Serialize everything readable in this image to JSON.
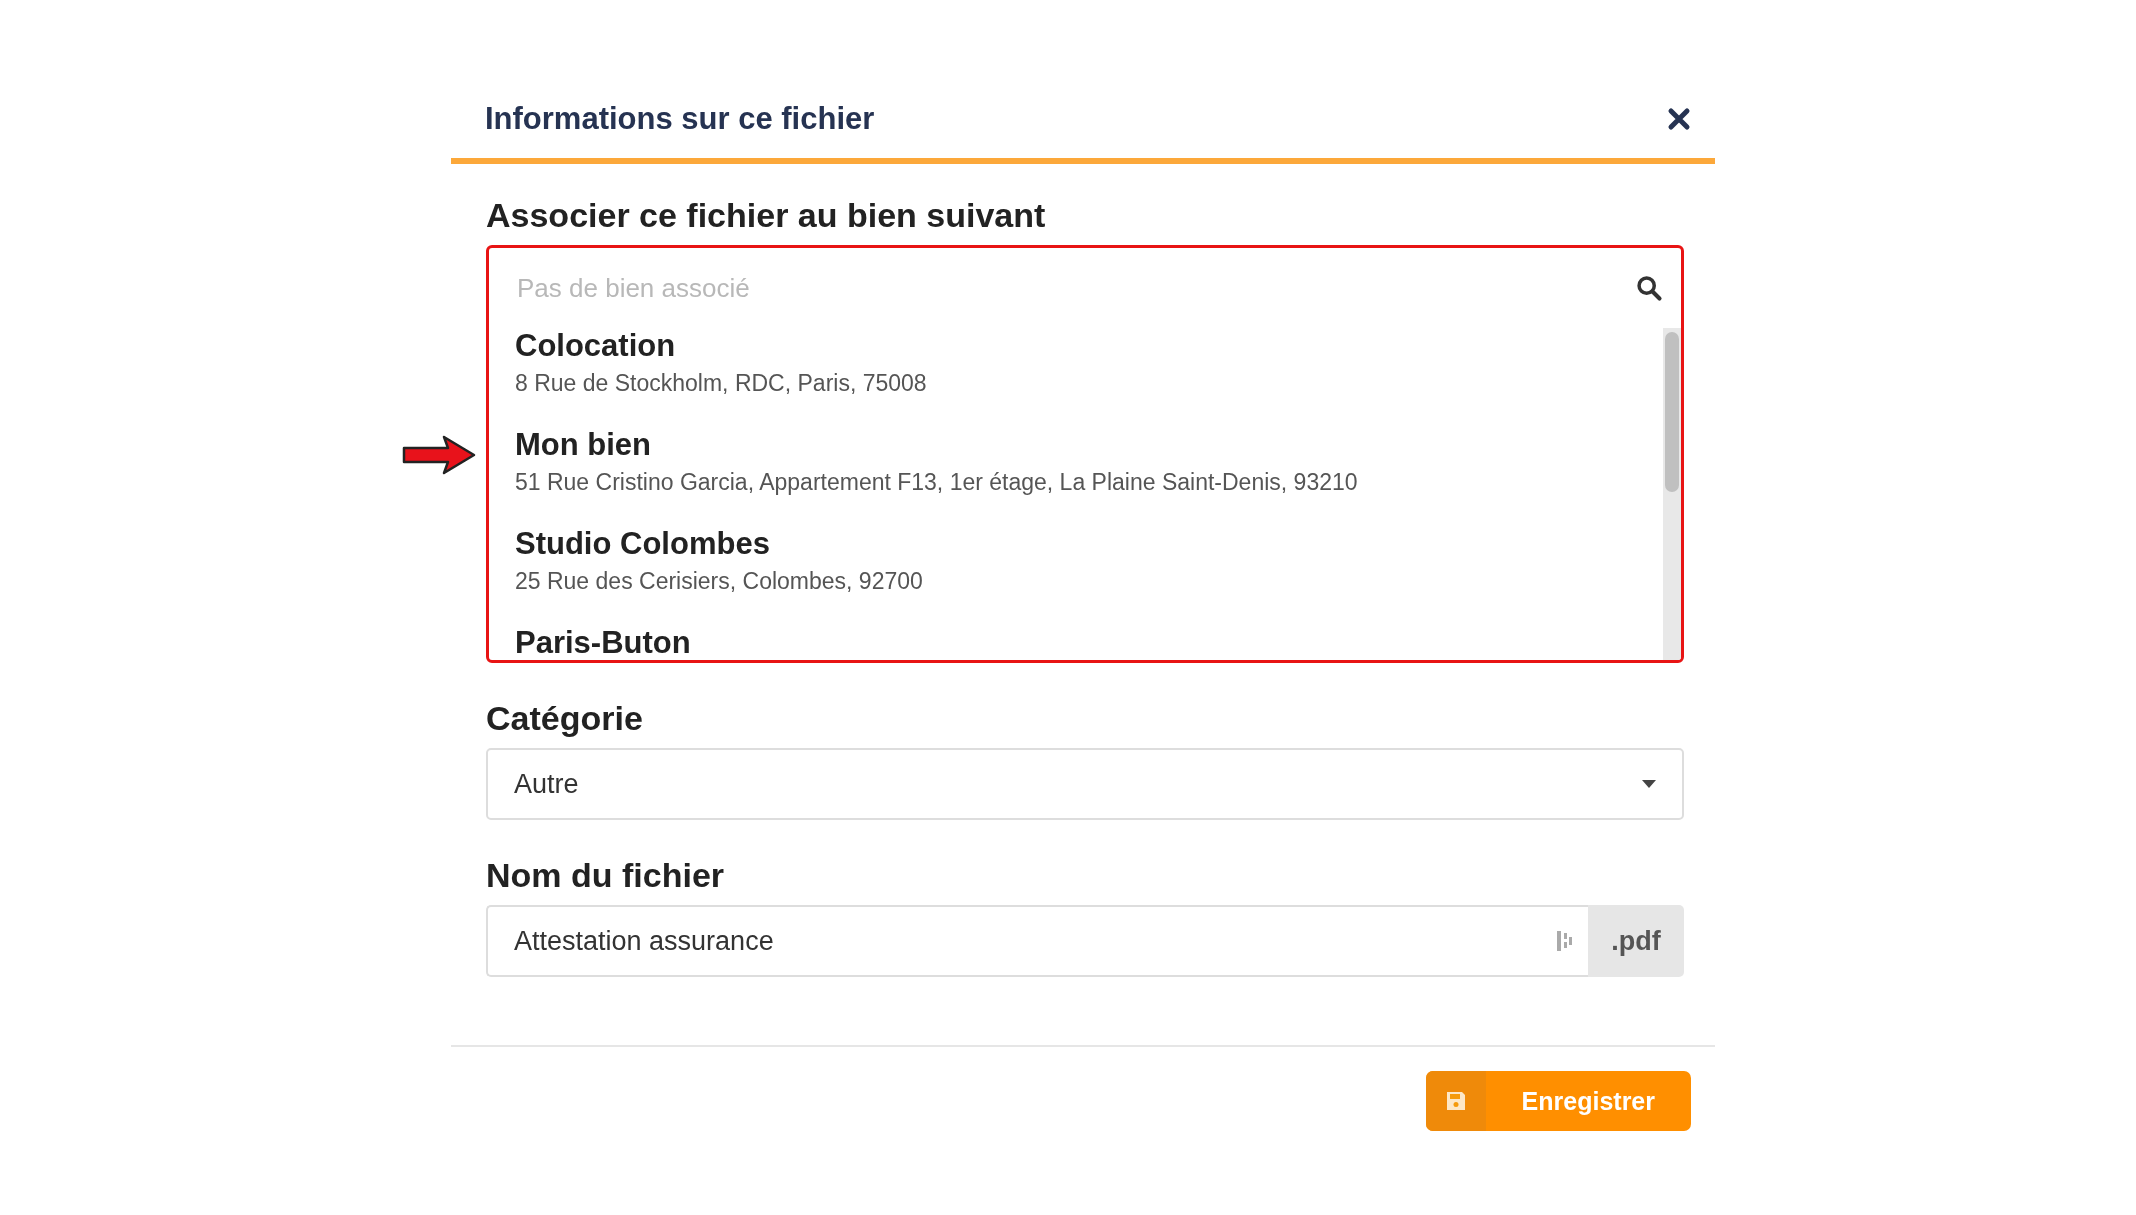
{
  "dialog": {
    "title": "Informations sur ce fichier"
  },
  "property": {
    "label": "Associer ce fichier au bien suivant",
    "search": {
      "placeholder": "Pas de bien associé"
    },
    "items": [
      {
        "name": "Colocation",
        "address": "8 Rue de Stockholm, RDC, Paris, 75008"
      },
      {
        "name": "Mon bien",
        "address": "51 Rue Cristino Garcia, Appartement F13, 1er étage, La Plaine Saint-Denis, 93210"
      },
      {
        "name": "Studio Colombes",
        "address": "25 Rue des Cerisiers, Colombes, 92700"
      },
      {
        "name": "Paris-Buton"
      }
    ]
  },
  "category": {
    "label": "Catégorie",
    "value": "Autre"
  },
  "filename": {
    "label": "Nom du fichier",
    "value": "Attestation assurance",
    "extension": ".pdf"
  },
  "save_button": {
    "label": "Enregistrer"
  }
}
